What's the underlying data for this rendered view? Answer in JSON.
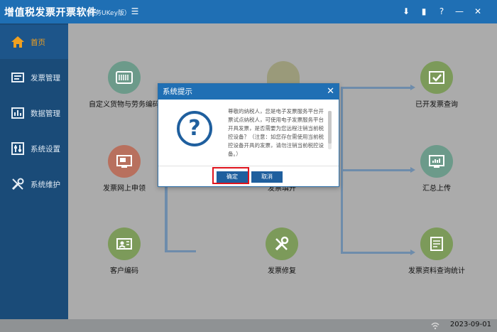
{
  "app": {
    "title": "增值税发票开票软件",
    "edition": "（税务UKey版）"
  },
  "titlebar_icons": [
    "download-icon",
    "info-icon",
    "help-icon",
    "minimize-icon",
    "close-icon"
  ],
  "sidebar": {
    "items": [
      {
        "label": "首页",
        "icon": "home-icon",
        "active": true
      },
      {
        "label": "发票管理",
        "icon": "invoice-icon"
      },
      {
        "label": "数据管理",
        "icon": "data-icon"
      },
      {
        "label": "系统设置",
        "icon": "settings-icon"
      },
      {
        "label": "系统维护",
        "icon": "tools-icon"
      }
    ]
  },
  "workflow": {
    "nodes": [
      {
        "label": "自定义货物与劳务编码",
        "color": "#6c9a8a"
      },
      {
        "label": "发票网上申领",
        "color": "#b8705e"
      },
      {
        "label": "客户编码",
        "color": "#7c9a5a"
      },
      {
        "label": "发票填开",
        "color": "#b09a5a"
      },
      {
        "label": "发票修复",
        "color": "#7c9a5a"
      },
      {
        "label": "已开发票查询",
        "color": "#7c9a5a"
      },
      {
        "label": "汇总上传",
        "color": "#6c9a8a"
      },
      {
        "label": "发票资料查询统计",
        "color": "#7c9a5a"
      }
    ]
  },
  "dialog": {
    "title": "系统提示",
    "message": "尊敬的纳税人，您是电子发票服务平台开票试点纳税人，可使用电子发票服务平台开具发票，是否需要为您远程注销当前税控设备？（注意：如您存在需使用当前税控设备开具的发票，请勿注销当前税控设备。）",
    "ok_label": "确定",
    "cancel_label": "取消"
  },
  "statusbar": {
    "date": "2023-09-01"
  },
  "colors": {
    "titlebar": "#1f6fb4",
    "sidebar": "#1a4b78",
    "button": "#1f5f9e",
    "highlight": "#e0141e"
  }
}
